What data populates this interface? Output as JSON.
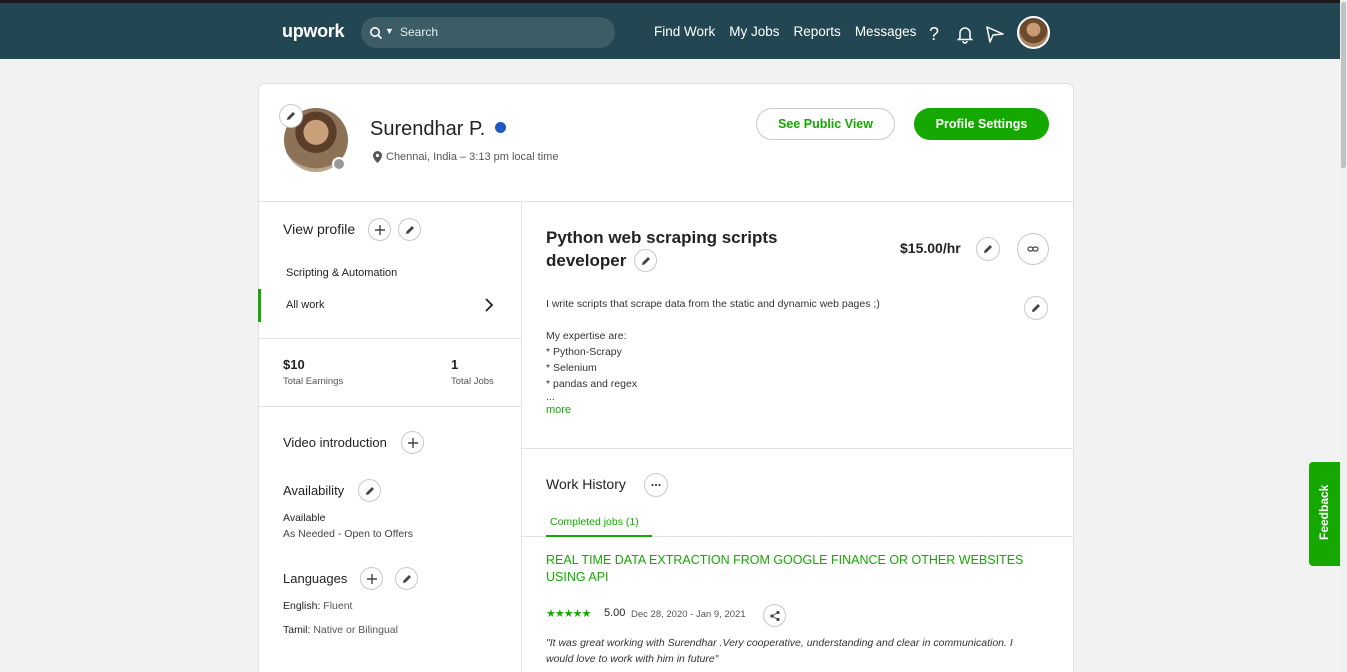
{
  "nav": {
    "logo": "upwork",
    "search_placeholder": "Search",
    "links": [
      "Find Work",
      "My Jobs",
      "Reports",
      "Messages"
    ],
    "icons": [
      "help-icon",
      "bell-icon",
      "send-icon",
      "avatar"
    ]
  },
  "profile": {
    "name": "Surendhar P.",
    "location": "Chennai, India – 3:13 pm local time",
    "see_public_view": "See Public View",
    "profile_settings": "Profile Settings"
  },
  "sidebar": {
    "view_profile": "View profile",
    "items": [
      "Scripting & Automation",
      "All work"
    ],
    "earnings_value": "$10",
    "earnings_label": "Total Earnings",
    "jobs_value": "1",
    "jobs_label": "Total Jobs",
    "video_intro": "Video introduction",
    "availability": "Availability",
    "availability_status": "Available",
    "availability_detail": "As Needed - Open to Offers",
    "languages": "Languages",
    "lang1_name": "English:",
    "lang1_level": "Fluent",
    "lang2_name": "Tamil:",
    "lang2_level": "Native or Bilingual"
  },
  "main": {
    "title": "Python web scraping scripts developer",
    "rate": "$15.00/hr",
    "desc_lines": [
      "I write scripts that scrape data from the static and dynamic web pages ;)",
      "",
      "My expertise are:",
      "* Python-Scrapy",
      "* Selenium",
      "* pandas and regex",
      "..."
    ],
    "more": "more",
    "work_history": "Work History",
    "completed_tab": "Completed jobs (1)",
    "job_title": "REAL TIME DATA EXTRACTION FROM GOOGLE FINANCE OR OTHER WEBSITES USING API",
    "stars": "★★★★★",
    "rating": "5.00",
    "dates": "Dec 28, 2020 - Jan 9, 2021",
    "quote": "\"It was great working with Surendhar .Very cooperative, understanding and clear in communication. I would love to work with him in future\""
  },
  "feedback": "Feedback",
  "colors": {
    "nav_bg": "#234752",
    "brand_green": "#14a800"
  }
}
